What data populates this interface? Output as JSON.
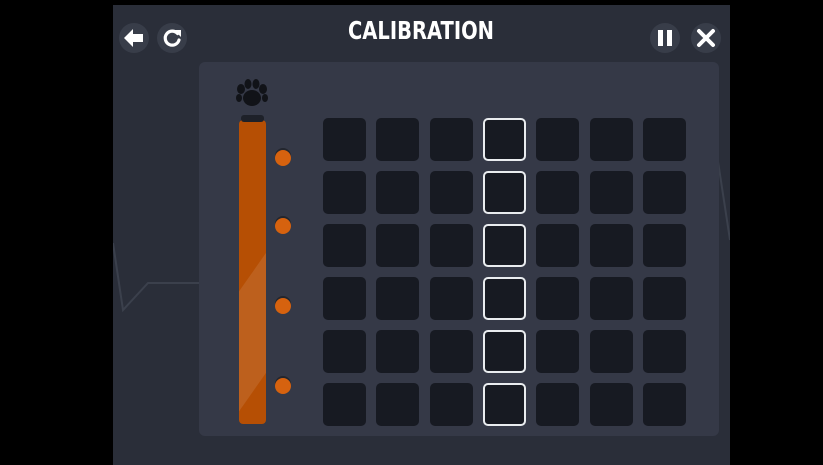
{
  "header": {
    "title": "CALIBRATION",
    "back_icon": "back-arrow-icon",
    "restart_icon": "restart-icon",
    "pause_icon": "pause-icon",
    "close_icon": "close-icon"
  },
  "meter": {
    "icon": "paw-icon",
    "level": 1.0,
    "markers": 4
  },
  "grid": {
    "rows": 6,
    "columns": 7,
    "highlighted_column": 4
  },
  "colors": {
    "background": "#2a2e39",
    "panel": "#353947",
    "cell": "#171a22",
    "meter_fill": "#b64f04",
    "marker": "#d6620f",
    "highlight_border": "#e9ecef"
  }
}
